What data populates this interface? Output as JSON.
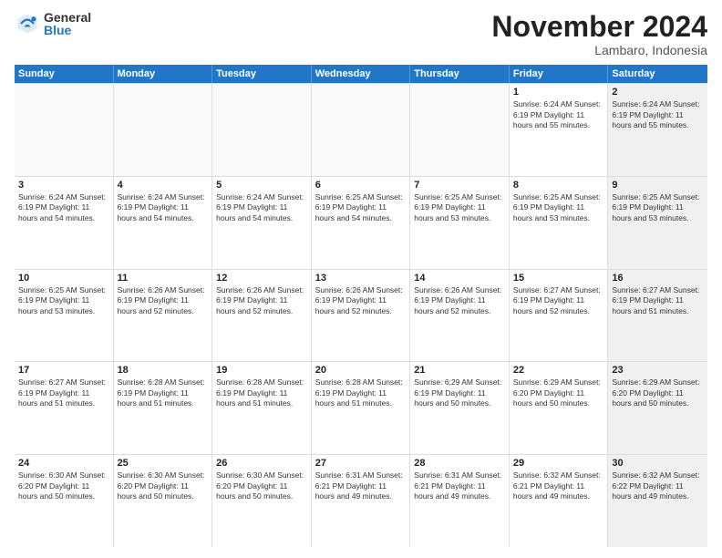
{
  "logo": {
    "general": "General",
    "blue": "Blue"
  },
  "title": "November 2024",
  "location": "Lambaro, Indonesia",
  "header_days": [
    "Sunday",
    "Monday",
    "Tuesday",
    "Wednesday",
    "Thursday",
    "Friday",
    "Saturday"
  ],
  "weeks": [
    [
      {
        "day": "",
        "content": "",
        "empty": true
      },
      {
        "day": "",
        "content": "",
        "empty": true
      },
      {
        "day": "",
        "content": "",
        "empty": true
      },
      {
        "day": "",
        "content": "",
        "empty": true
      },
      {
        "day": "",
        "content": "",
        "empty": true
      },
      {
        "day": "1",
        "content": "Sunrise: 6:24 AM\nSunset: 6:19 PM\nDaylight: 11 hours and 55 minutes.",
        "empty": false
      },
      {
        "day": "2",
        "content": "Sunrise: 6:24 AM\nSunset: 6:19 PM\nDaylight: 11 hours and 55 minutes.",
        "empty": false,
        "shaded": true
      }
    ],
    [
      {
        "day": "3",
        "content": "Sunrise: 6:24 AM\nSunset: 6:19 PM\nDaylight: 11 hours and 54 minutes.",
        "empty": false
      },
      {
        "day": "4",
        "content": "Sunrise: 6:24 AM\nSunset: 6:19 PM\nDaylight: 11 hours and 54 minutes.",
        "empty": false
      },
      {
        "day": "5",
        "content": "Sunrise: 6:24 AM\nSunset: 6:19 PM\nDaylight: 11 hours and 54 minutes.",
        "empty": false
      },
      {
        "day": "6",
        "content": "Sunrise: 6:25 AM\nSunset: 6:19 PM\nDaylight: 11 hours and 54 minutes.",
        "empty": false
      },
      {
        "day": "7",
        "content": "Sunrise: 6:25 AM\nSunset: 6:19 PM\nDaylight: 11 hours and 53 minutes.",
        "empty": false
      },
      {
        "day": "8",
        "content": "Sunrise: 6:25 AM\nSunset: 6:19 PM\nDaylight: 11 hours and 53 minutes.",
        "empty": false
      },
      {
        "day": "9",
        "content": "Sunrise: 6:25 AM\nSunset: 6:19 PM\nDaylight: 11 hours and 53 minutes.",
        "empty": false,
        "shaded": true
      }
    ],
    [
      {
        "day": "10",
        "content": "Sunrise: 6:25 AM\nSunset: 6:19 PM\nDaylight: 11 hours and 53 minutes.",
        "empty": false
      },
      {
        "day": "11",
        "content": "Sunrise: 6:26 AM\nSunset: 6:19 PM\nDaylight: 11 hours and 52 minutes.",
        "empty": false
      },
      {
        "day": "12",
        "content": "Sunrise: 6:26 AM\nSunset: 6:19 PM\nDaylight: 11 hours and 52 minutes.",
        "empty": false
      },
      {
        "day": "13",
        "content": "Sunrise: 6:26 AM\nSunset: 6:19 PM\nDaylight: 11 hours and 52 minutes.",
        "empty": false
      },
      {
        "day": "14",
        "content": "Sunrise: 6:26 AM\nSunset: 6:19 PM\nDaylight: 11 hours and 52 minutes.",
        "empty": false
      },
      {
        "day": "15",
        "content": "Sunrise: 6:27 AM\nSunset: 6:19 PM\nDaylight: 11 hours and 52 minutes.",
        "empty": false
      },
      {
        "day": "16",
        "content": "Sunrise: 6:27 AM\nSunset: 6:19 PM\nDaylight: 11 hours and 51 minutes.",
        "empty": false,
        "shaded": true
      }
    ],
    [
      {
        "day": "17",
        "content": "Sunrise: 6:27 AM\nSunset: 6:19 PM\nDaylight: 11 hours and 51 minutes.",
        "empty": false
      },
      {
        "day": "18",
        "content": "Sunrise: 6:28 AM\nSunset: 6:19 PM\nDaylight: 11 hours and 51 minutes.",
        "empty": false
      },
      {
        "day": "19",
        "content": "Sunrise: 6:28 AM\nSunset: 6:19 PM\nDaylight: 11 hours and 51 minutes.",
        "empty": false
      },
      {
        "day": "20",
        "content": "Sunrise: 6:28 AM\nSunset: 6:19 PM\nDaylight: 11 hours and 51 minutes.",
        "empty": false
      },
      {
        "day": "21",
        "content": "Sunrise: 6:29 AM\nSunset: 6:19 PM\nDaylight: 11 hours and 50 minutes.",
        "empty": false
      },
      {
        "day": "22",
        "content": "Sunrise: 6:29 AM\nSunset: 6:20 PM\nDaylight: 11 hours and 50 minutes.",
        "empty": false
      },
      {
        "day": "23",
        "content": "Sunrise: 6:29 AM\nSunset: 6:20 PM\nDaylight: 11 hours and 50 minutes.",
        "empty": false,
        "shaded": true
      }
    ],
    [
      {
        "day": "24",
        "content": "Sunrise: 6:30 AM\nSunset: 6:20 PM\nDaylight: 11 hours and 50 minutes.",
        "empty": false
      },
      {
        "day": "25",
        "content": "Sunrise: 6:30 AM\nSunset: 6:20 PM\nDaylight: 11 hours and 50 minutes.",
        "empty": false
      },
      {
        "day": "26",
        "content": "Sunrise: 6:30 AM\nSunset: 6:20 PM\nDaylight: 11 hours and 50 minutes.",
        "empty": false
      },
      {
        "day": "27",
        "content": "Sunrise: 6:31 AM\nSunset: 6:21 PM\nDaylight: 11 hours and 49 minutes.",
        "empty": false
      },
      {
        "day": "28",
        "content": "Sunrise: 6:31 AM\nSunset: 6:21 PM\nDaylight: 11 hours and 49 minutes.",
        "empty": false
      },
      {
        "day": "29",
        "content": "Sunrise: 6:32 AM\nSunset: 6:21 PM\nDaylight: 11 hours and 49 minutes.",
        "empty": false
      },
      {
        "day": "30",
        "content": "Sunrise: 6:32 AM\nSunset: 6:22 PM\nDaylight: 11 hours and 49 minutes.",
        "empty": false,
        "shaded": true
      }
    ]
  ]
}
